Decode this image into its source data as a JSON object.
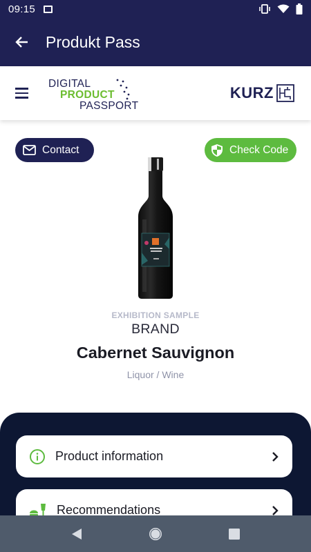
{
  "status_bar": {
    "time": "09:15"
  },
  "app_bar": {
    "title": "Produkt Pass"
  },
  "header": {
    "logo_line1": "DIGITAL",
    "logo_line2": "PRODUCT",
    "logo_line3": "PASSPORT",
    "partner_logo": "KURZ"
  },
  "actions": {
    "contact_label": "Contact",
    "check_code_label": "Check Code"
  },
  "product": {
    "exhibition_label": "EXHIBITION SAMPLE",
    "brand": "BRAND",
    "name": "Cabernet Sauvignon",
    "category": "Liquor / Wine"
  },
  "menu": {
    "items": [
      {
        "label": "Product information",
        "icon": "info-icon"
      },
      {
        "label": "Recommendations",
        "icon": "food-drink-icon"
      }
    ]
  },
  "colors": {
    "navy": "#1f2154",
    "green": "#5dbb3f",
    "panel": "#0d1733",
    "nav": "#4f5b6b"
  }
}
